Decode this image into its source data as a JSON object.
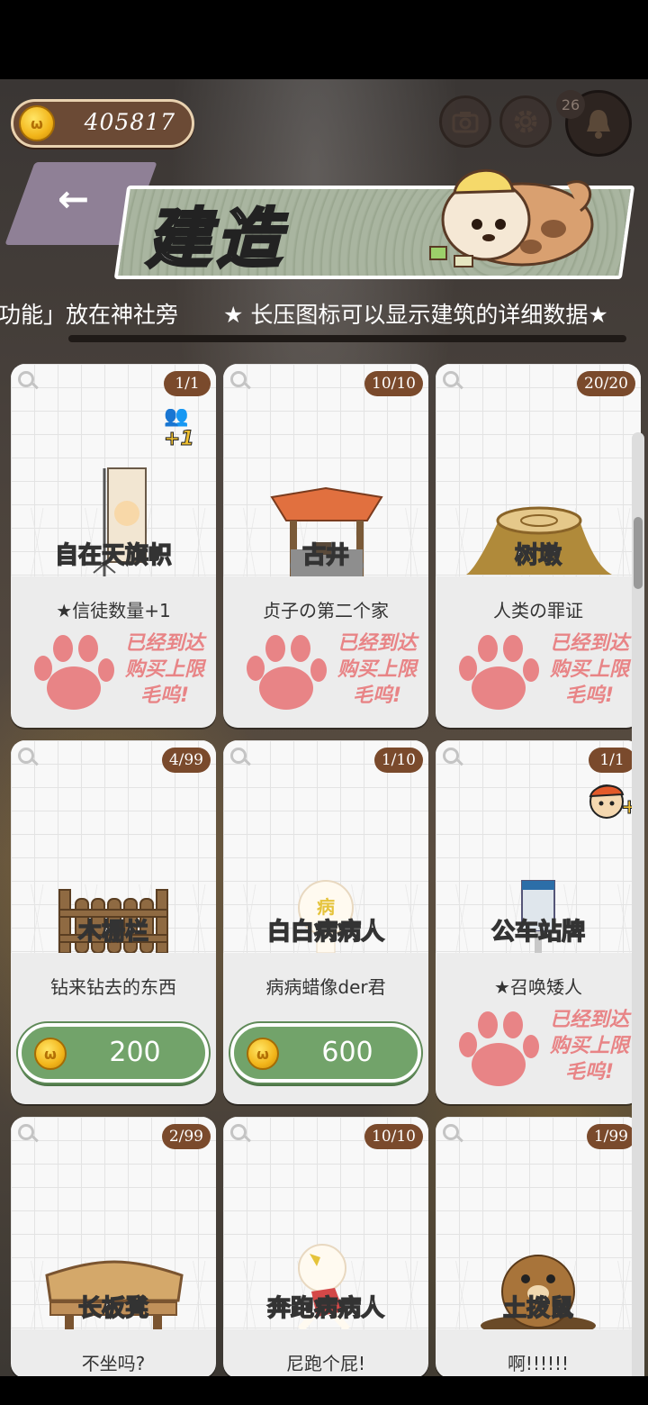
{
  "header": {
    "coins": "405817",
    "title": "建造",
    "bell_badge": "26",
    "back_label": "←"
  },
  "ticker": {
    "text": "功能」放在神社旁　　★ 长压图标可以显示建筑的详细数据★"
  },
  "limit_text": [
    "已经到达",
    "购买上限",
    "毛呜!"
  ],
  "buildings": [
    {
      "name": "自在天旗帜",
      "count": "1/1",
      "desc": "★信徒数量+1",
      "status": "limit",
      "badge": "+1"
    },
    {
      "name": "古井",
      "count": "10/10",
      "desc": "贞子の第二个家",
      "status": "limit"
    },
    {
      "name": "树墩",
      "count": "20/20",
      "desc": "人类の罪证",
      "status": "limit"
    },
    {
      "name": "木栅栏",
      "count": "4/99",
      "desc": "钻来钻去的东西",
      "status": "buy",
      "price": "200"
    },
    {
      "name": "白白病病人",
      "count": "1/10",
      "desc": "病病蜡像der君",
      "status": "buy",
      "price": "600"
    },
    {
      "name": "公车站牌",
      "count": "1/1",
      "desc": "★召唤矮人",
      "status": "limit",
      "badge": "+"
    },
    {
      "name": "长板凳",
      "count": "2/99",
      "desc": "不坐吗?"
    },
    {
      "name": "奔跑病病人",
      "count": "10/10",
      "desc": "尼跑个屁!"
    },
    {
      "name": "土拨鼠",
      "count": "1/99",
      "desc": "啊!!!!!!"
    }
  ],
  "colors": {
    "accent_brown": "#7a4a2c",
    "buy_green": "#72a36a",
    "limit_pink": "#e88486",
    "title_banner": "#a9b5a0"
  },
  "icons": [
    "coin-icon",
    "camera-icon",
    "gear-icon",
    "bell-icon",
    "back-arrow-icon",
    "magnifier-icon",
    "paw-icon"
  ]
}
